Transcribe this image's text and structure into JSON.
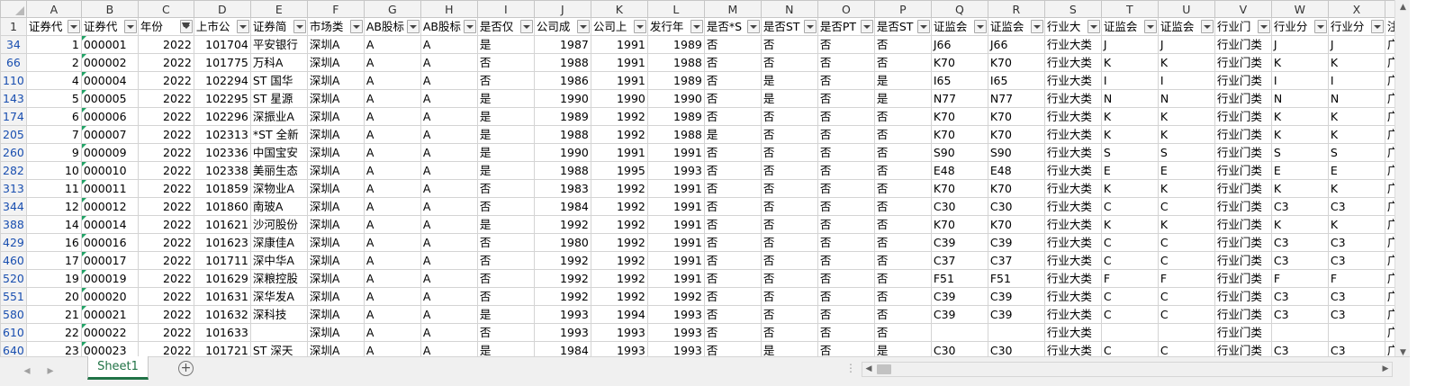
{
  "columns": [
    "A",
    "B",
    "C",
    "D",
    "E",
    "F",
    "G",
    "H",
    "I",
    "J",
    "K",
    "L",
    "M",
    "N",
    "O",
    "P",
    "Q",
    "R",
    "S",
    "T",
    "U",
    "V",
    "W",
    "X",
    ""
  ],
  "header_row_number": "1",
  "headers": [
    "证券代",
    "证券代",
    "年份",
    "上市公",
    "证券简",
    "市场类",
    "AB股标",
    "AB股标",
    "是否仅",
    "公司成",
    "公司上",
    "发行年",
    "是否*S",
    "是否ST",
    "是否PT",
    "是否ST",
    "证监会",
    "证监会",
    "行业大",
    "证监会",
    "证监会",
    "行业门",
    "行业分",
    "行业分",
    "注"
  ],
  "filtered_column_index": 2,
  "rows": [
    {
      "rn": "34",
      "c": [
        "1",
        "000001",
        "2022",
        "101704",
        "平安银行",
        "深圳A",
        "A",
        "A",
        "是",
        "1987",
        "1991",
        "1989",
        "否",
        "否",
        "否",
        "否",
        "J66",
        "J66",
        "行业大类",
        "J",
        "J",
        "行业门类",
        "J",
        "J",
        "广"
      ]
    },
    {
      "rn": "66",
      "c": [
        "2",
        "000002",
        "2022",
        "101775",
        "万科A",
        "深圳A",
        "A",
        "A",
        "否",
        "1988",
        "1991",
        "1988",
        "否",
        "否",
        "否",
        "否",
        "K70",
        "K70",
        "行业大类",
        "K",
        "K",
        "行业门类",
        "K",
        "K",
        "广"
      ]
    },
    {
      "rn": "110",
      "c": [
        "4",
        "000004",
        "2022",
        "102294",
        "ST 国华",
        "深圳A",
        "A",
        "A",
        "否",
        "1986",
        "1991",
        "1989",
        "否",
        "是",
        "否",
        "是",
        "I65",
        "I65",
        "行业大类",
        "I",
        "I",
        "行业门类",
        "I",
        "I",
        "广"
      ]
    },
    {
      "rn": "143",
      "c": [
        "5",
        "000005",
        "2022",
        "102295",
        "ST 星源",
        "深圳A",
        "A",
        "A",
        "是",
        "1990",
        "1990",
        "1990",
        "否",
        "是",
        "否",
        "是",
        "N77",
        "N77",
        "行业大类",
        "N",
        "N",
        "行业门类",
        "N",
        "N",
        "广"
      ]
    },
    {
      "rn": "174",
      "c": [
        "6",
        "000006",
        "2022",
        "102296",
        "深振业A",
        "深圳A",
        "A",
        "A",
        "是",
        "1989",
        "1992",
        "1989",
        "否",
        "否",
        "否",
        "否",
        "K70",
        "K70",
        "行业大类",
        "K",
        "K",
        "行业门类",
        "K",
        "K",
        "广"
      ]
    },
    {
      "rn": "205",
      "c": [
        "7",
        "000007",
        "2022",
        "102313",
        "*ST 全新",
        "深圳A",
        "A",
        "A",
        "是",
        "1988",
        "1992",
        "1988",
        "是",
        "否",
        "否",
        "否",
        "K70",
        "K70",
        "行业大类",
        "K",
        "K",
        "行业门类",
        "K",
        "K",
        "广"
      ]
    },
    {
      "rn": "260",
      "c": [
        "9",
        "000009",
        "2022",
        "102336",
        "中国宝安",
        "深圳A",
        "A",
        "A",
        "是",
        "1990",
        "1991",
        "1991",
        "否",
        "否",
        "否",
        "否",
        "S90",
        "S90",
        "行业大类",
        "S",
        "S",
        "行业门类",
        "S",
        "S",
        "广"
      ]
    },
    {
      "rn": "282",
      "c": [
        "10",
        "000010",
        "2022",
        "102338",
        "美丽生态",
        "深圳A",
        "A",
        "A",
        "是",
        "1988",
        "1995",
        "1993",
        "否",
        "否",
        "否",
        "否",
        "E48",
        "E48",
        "行业大类",
        "E",
        "E",
        "行业门类",
        "E",
        "E",
        "广"
      ]
    },
    {
      "rn": "313",
      "c": [
        "11",
        "000011",
        "2022",
        "101859",
        "深物业A",
        "深圳A",
        "A",
        "A",
        "否",
        "1983",
        "1992",
        "1991",
        "否",
        "否",
        "否",
        "否",
        "K70",
        "K70",
        "行业大类",
        "K",
        "K",
        "行业门类",
        "K",
        "K",
        "广"
      ]
    },
    {
      "rn": "344",
      "c": [
        "12",
        "000012",
        "2022",
        "101860",
        "南玻A",
        "深圳A",
        "A",
        "A",
        "否",
        "1984",
        "1992",
        "1991",
        "否",
        "否",
        "否",
        "否",
        "C30",
        "C30",
        "行业大类",
        "C",
        "C",
        "行业门类",
        "C3",
        "C3",
        "广"
      ]
    },
    {
      "rn": "388",
      "c": [
        "14",
        "000014",
        "2022",
        "101621",
        "沙河股份",
        "深圳A",
        "A",
        "A",
        "是",
        "1992",
        "1992",
        "1991",
        "否",
        "否",
        "否",
        "否",
        "K70",
        "K70",
        "行业大类",
        "K",
        "K",
        "行业门类",
        "K",
        "K",
        "广"
      ]
    },
    {
      "rn": "429",
      "c": [
        "16",
        "000016",
        "2022",
        "101623",
        "深康佳A",
        "深圳A",
        "A",
        "A",
        "否",
        "1980",
        "1992",
        "1991",
        "否",
        "否",
        "否",
        "否",
        "C39",
        "C39",
        "行业大类",
        "C",
        "C",
        "行业门类",
        "C3",
        "C3",
        "广"
      ]
    },
    {
      "rn": "460",
      "c": [
        "17",
        "000017",
        "2022",
        "101711",
        "深中华A",
        "深圳A",
        "A",
        "A",
        "否",
        "1992",
        "1992",
        "1991",
        "否",
        "否",
        "否",
        "否",
        "C37",
        "C37",
        "行业大类",
        "C",
        "C",
        "行业门类",
        "C3",
        "C3",
        "广"
      ]
    },
    {
      "rn": "520",
      "c": [
        "19",
        "000019",
        "2022",
        "101629",
        "深粮控股",
        "深圳A",
        "A",
        "A",
        "否",
        "1992",
        "1992",
        "1991",
        "否",
        "否",
        "否",
        "否",
        "F51",
        "F51",
        "行业大类",
        "F",
        "F",
        "行业门类",
        "F",
        "F",
        "广"
      ]
    },
    {
      "rn": "551",
      "c": [
        "20",
        "000020",
        "2022",
        "101631",
        "深华发A",
        "深圳A",
        "A",
        "A",
        "否",
        "1992",
        "1992",
        "1992",
        "否",
        "否",
        "否",
        "否",
        "C39",
        "C39",
        "行业大类",
        "C",
        "C",
        "行业门类",
        "C3",
        "C3",
        "广"
      ]
    },
    {
      "rn": "580",
      "c": [
        "21",
        "000021",
        "2022",
        "101632",
        "深科技",
        "深圳A",
        "A",
        "A",
        "是",
        "1993",
        "1994",
        "1993",
        "否",
        "否",
        "否",
        "否",
        "C39",
        "C39",
        "行业大类",
        "C",
        "C",
        "行业门类",
        "C3",
        "C3",
        "广"
      ]
    },
    {
      "rn": "610",
      "c": [
        "22",
        "000022",
        "2022",
        "101633",
        "",
        "深圳A",
        "A",
        "A",
        "否",
        "1993",
        "1993",
        "1993",
        "否",
        "否",
        "否",
        "否",
        "",
        "",
        "行业大类",
        "",
        "",
        "行业门类",
        "",
        "",
        "广"
      ]
    },
    {
      "rn": "640",
      "c": [
        "23",
        "000023",
        "2022",
        "101721",
        "ST 深天",
        "深圳A",
        "A",
        "A",
        "是",
        "1984",
        "1993",
        "1993",
        "否",
        "是",
        "否",
        "是",
        "C30",
        "C30",
        "行业大类",
        "C",
        "C",
        "行业门类",
        "C3",
        "C3",
        "广"
      ]
    }
  ],
  "sheet_tab": "Sheet1",
  "add_sheet_symbol": "+",
  "nav_prev": "◂",
  "nav_next": "▸",
  "split_dots": "⋮",
  "scroll_up": "▲",
  "scroll_down": "▼",
  "scroll_left": "◀",
  "scroll_right": "▶",
  "accent_color": "#217346",
  "row_number_color": "#1a4fb0"
}
